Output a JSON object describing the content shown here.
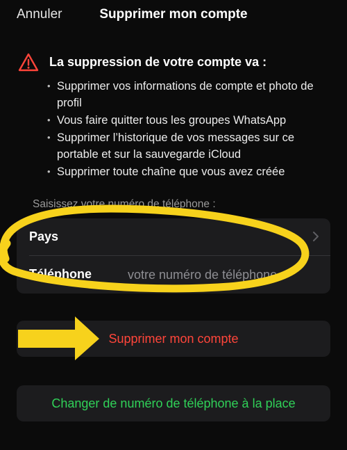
{
  "navbar": {
    "cancel_label": "Annuler",
    "title": "Supprimer mon compte"
  },
  "warning": {
    "icon": "warning-triangle-icon",
    "heading": "La suppression de votre compte va :",
    "items": [
      "Supprimer vos informations de compte et photo de profil",
      "Vous faire quitter tous les groupes WhatsApp",
      "Supprimer l’historique de vos messages sur ce portable et sur la sauvegarde iCloud",
      "Supprimer toute chaîne que vous avez créée"
    ]
  },
  "phone_form": {
    "section_label": "Saisissez votre numéro de téléphone :",
    "country_label": "Pays",
    "phone_label": "Téléphone",
    "phone_placeholder": "votre numéro de téléphone"
  },
  "actions": {
    "delete_label": "Supprimer mon compte",
    "change_number_label": "Changer de numéro de téléphone à la place"
  },
  "colors": {
    "background": "#0b0b0b",
    "card": "#1c1c1e",
    "destructive": "#ff453a",
    "positive": "#30d158",
    "annotation": "#f7d21c"
  }
}
